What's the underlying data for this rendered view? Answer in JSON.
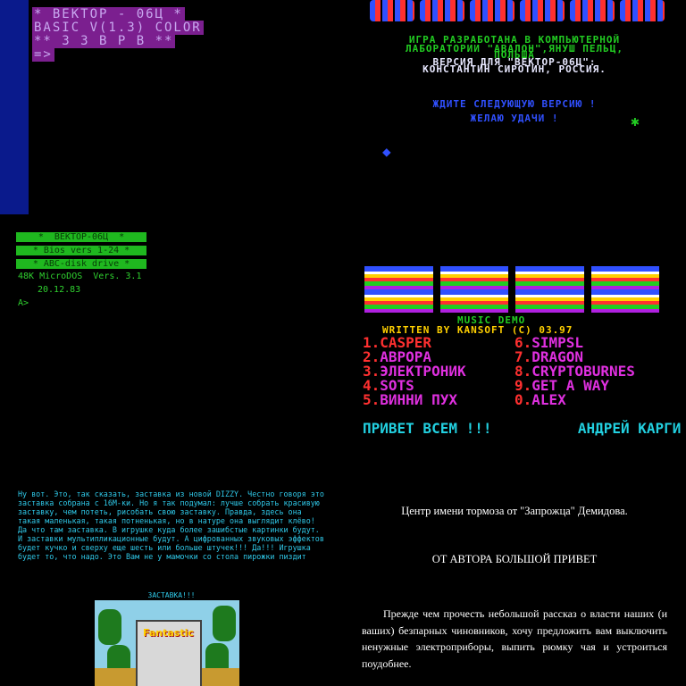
{
  "basic_boot": {
    "lines": [
      "* ВЕКТОР - 06Ц *",
      "BASIC V(1.3) COLOR",
      "** 3 3 В Р В **",
      "=>"
    ],
    "colors": {
      "border": "#0a1a8c",
      "highlight": "#7b1f8f",
      "text": "#c9a8f0"
    }
  },
  "credits": {
    "line1": "ИГРА РАЗРАБОТАНА В КОМПЬЮТЕРНОЙ",
    "line2": "ЛАБОРАТОРИИ \"АВАЛОН\",ЯНУШ ПЕЛЬЦ,",
    "line3": "ПОЛЬША",
    "line4": "ВЕРСИЯ ДЛЯ \"ВЕКТОР-06Ц\":",
    "line5": "КОНСТАНТИН СИРОТИН, РОССИЯ.",
    "line6": "ЖДИТЕ СЛЕДУЮЩУЮ ВЕРСИЮ !",
    "line7": "ЖЕЛАЮ УДАЧИ !",
    "icons": [
      "bug-sprite-icon",
      "ship-sprite-icon"
    ]
  },
  "microdos": {
    "bar1": "*  ВЕКТОР-06Ц  *",
    "bar2": "* Bios vers 1-24 *",
    "bar3": "* ABC-disk drive *",
    "line1": "48K MicroDOS  Vers. 3.1",
    "line2": "20.12.83",
    "prompt": "A>"
  },
  "real_demo": {
    "logo": "REAL",
    "subtitle": "MUSIC DEMO",
    "credit": "WRITTEN BY KANSOFT (C) 03.97",
    "tracks_left": [
      {
        "num": "1.",
        "name": "CASPER",
        "color": "#ff3030"
      },
      {
        "num": "2.",
        "name": "АВРОРА",
        "color": "#e030e0"
      },
      {
        "num": "3.",
        "name": "ЭЛЕКТРОНИК",
        "color": "#e030e0"
      },
      {
        "num": "4.",
        "name": "SOTS",
        "color": "#e030e0"
      },
      {
        "num": "5.",
        "name": "ВИННИ ПУХ",
        "color": "#e030e0"
      }
    ],
    "tracks_right": [
      {
        "num": "6.",
        "name": "SIMPSL",
        "color": "#e030e0"
      },
      {
        "num": "7.",
        "name": "DRAGON",
        "color": "#e030e0"
      },
      {
        "num": "8.",
        "name": "CRYPTOBURNES",
        "color": "#e030e0"
      },
      {
        "num": "9.",
        "name": "GET A WAY",
        "color": "#e030e0"
      },
      {
        "num": "0.",
        "name": "ALEX",
        "color": "#e030e0"
      }
    ],
    "scroller": "ПРИВЕТ ВСЕМ !!!          АНДРЕЙ КАРГИ"
  },
  "dizzy_note": {
    "text": "Ну вот. Это, так сказать, заставка из новой DIZZY. Честно говоря это заставка собрана с 16М-ки. Но я так подумал: лучше собрать красивую заставку, чем потеть, рисобать свою заставку. Правда, здесь она такая маленькая, такая потненькая, но в натуре она выглядит клёво! Да что там заставка. В игрушке куда более зашибстые картинки будут. И заставки мультипликационные будут. А цифрованных звуковых эффектов будет кучко и сверху еще шесть или больше штучек!!! Да!!! Игрушка будет то, что надо. Это Вам не у мамочки со стола пирожки пиздит",
    "caption": "ЗАСТАВКА!!!",
    "image_logo": "Fantastic"
  },
  "document": {
    "header": "Центр имени тормоза от \"Запрожца\" Демидова.",
    "heading": "ОТ АВТОРА БОЛЬШОЙ ПРИВЕТ",
    "body": "Прежде чем прочесть небольшой рассказ о власти наших (и ваших) безпарных чиновников, хочу предложить вам выключить ненужные электроприборы, выпить рюмку чая и устроиться поудобнее."
  }
}
